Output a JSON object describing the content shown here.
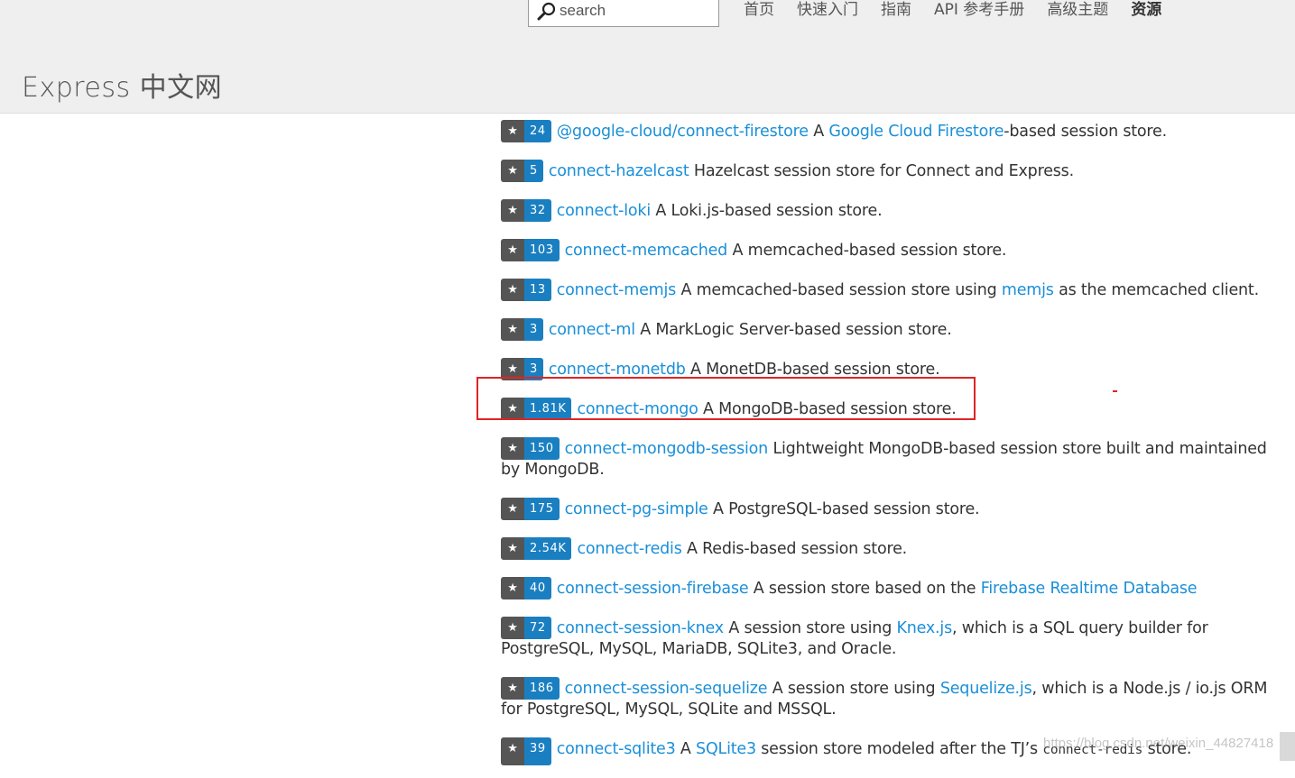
{
  "header": {
    "brand": "Express 中文网",
    "search_placeholder": "search",
    "nav": [
      "首页",
      "快速入门",
      "指南",
      "API 参考手册",
      "高级主题",
      "资源"
    ],
    "active_nav": "资源"
  },
  "entries": [
    {
      "stars": "24",
      "name": "@google-cloud/connect-firestore",
      "parts": [
        {
          "t": " A "
        },
        {
          "link": "Google Cloud Firestore"
        },
        {
          "t": "-based session store."
        }
      ]
    },
    {
      "stars": "5",
      "name": "connect-hazelcast",
      "parts": [
        {
          "t": " Hazelcast session store for Connect and Express."
        }
      ]
    },
    {
      "stars": "32",
      "name": "connect-loki",
      "parts": [
        {
          "t": " A Loki.js-based session store."
        }
      ]
    },
    {
      "stars": "103",
      "name": "connect-memcached",
      "parts": [
        {
          "t": " A memcached-based session store."
        }
      ]
    },
    {
      "stars": "13",
      "name": "connect-memjs",
      "parts": [
        {
          "t": " A memcached-based session store using "
        },
        {
          "link": "memjs"
        },
        {
          "t": " as the memcached client."
        }
      ]
    },
    {
      "stars": "3",
      "name": "connect-ml",
      "parts": [
        {
          "t": " A MarkLogic Server-based session store."
        }
      ]
    },
    {
      "stars": "3",
      "name": "connect-monetdb",
      "parts": [
        {
          "t": " A MonetDB-based session store."
        }
      ]
    },
    {
      "stars": "1.81K",
      "name": "connect-mongo",
      "parts": [
        {
          "t": " A MongoDB-based session store."
        }
      ]
    },
    {
      "stars": "150",
      "name": "connect-mongodb-session",
      "parts": [
        {
          "t": " Lightweight MongoDB-based session store built and maintained by MongoDB."
        }
      ]
    },
    {
      "stars": "175",
      "name": "connect-pg-simple",
      "parts": [
        {
          "t": " A PostgreSQL-based session store."
        }
      ]
    },
    {
      "stars": "2.54K",
      "name": "connect-redis",
      "parts": [
        {
          "t": " A Redis-based session store."
        }
      ]
    },
    {
      "stars": "40",
      "name": "connect-session-firebase",
      "parts": [
        {
          "t": " A session store based on the "
        },
        {
          "link": "Firebase Realtime Database"
        }
      ]
    },
    {
      "stars": "72",
      "name": "connect-session-knex",
      "parts": [
        {
          "t": " A session store using "
        },
        {
          "link": "Knex.js"
        },
        {
          "t": ", which is a SQL query builder for PostgreSQL, MySQL, MariaDB, SQLite3, and Oracle."
        }
      ]
    },
    {
      "stars": "186",
      "name": "connect-session-sequelize",
      "parts": [
        {
          "t": " A session store using "
        },
        {
          "link": "Sequelize.js"
        },
        {
          "t": ", which is a Node.js / io.js ORM for PostgreSQL, MySQL, SQLite and MSSQL."
        }
      ]
    },
    {
      "stars": "39",
      "name": "connect-sqlite3",
      "parts": [
        {
          "t": " A "
        },
        {
          "link": "SQLite3"
        },
        {
          "t": " session store modeled after the TJ’s "
        },
        {
          "code": "connect-redis"
        },
        {
          "t": " store."
        }
      ]
    }
  ],
  "star_glyph": "★",
  "watermark": "https://blog.csdn.net/weixin_44827418",
  "colors": {
    "link": "#1a8fd8",
    "badge_count": "#1a7fc1",
    "badge_star": "#555555",
    "highlight": "#e02424"
  }
}
